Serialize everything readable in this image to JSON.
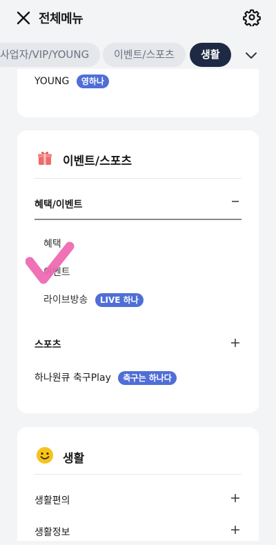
{
  "header": {
    "title": "전체메뉴",
    "close_icon": "close-icon",
    "settings_icon": "gear-icon"
  },
  "tabs": [
    {
      "label": "사업자/VIP/YOUNG",
      "active": false
    },
    {
      "label": "이벤트/스포츠",
      "active": false
    },
    {
      "label": "생활",
      "active": true
    }
  ],
  "young_card": {
    "label": "YOUNG",
    "badge": "영하나"
  },
  "events_card": {
    "title": "이벤트/스포츠",
    "icon": "gift-icon",
    "group_header": "혜택/이벤트",
    "sub_items": [
      {
        "label": "혜택"
      },
      {
        "label": "이벤트"
      },
      {
        "label": "라이브방송",
        "badge": "LIVE 하나"
      }
    ],
    "sports_label": "스포츠",
    "soccer_label": "하나원큐 축구Play",
    "soccer_badge": "축구는 하나다"
  },
  "life_card": {
    "title": "생활",
    "icon": "smile-icon",
    "rows": [
      {
        "label": "생활편의"
      },
      {
        "label": "생활정보"
      }
    ]
  },
  "colors": {
    "accent": "#1e2a44",
    "badge": "#4f6ed6",
    "checkmark": "#ee66b0"
  }
}
